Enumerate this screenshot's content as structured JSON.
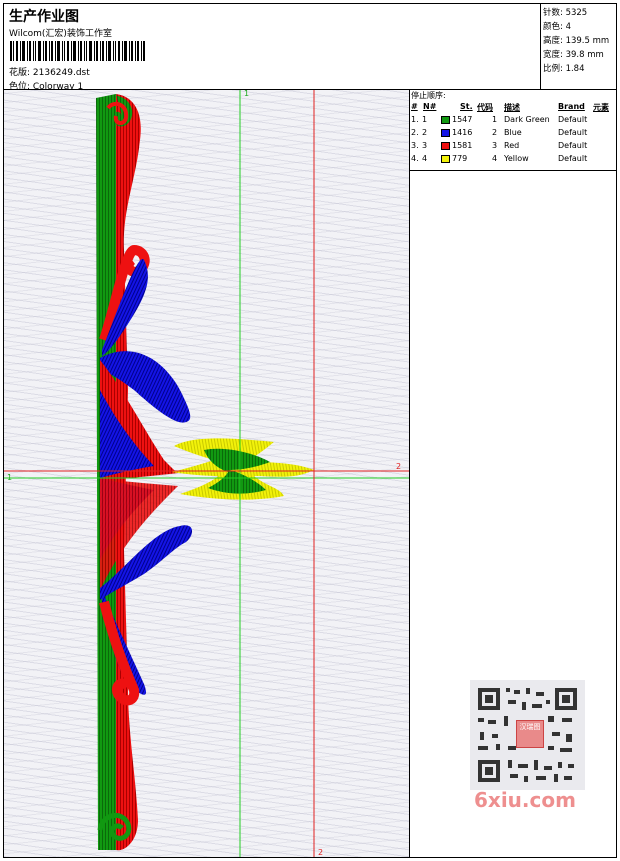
{
  "header": {
    "title": "生产作业图",
    "company": "Wilcom(汇宏)装饰工作室",
    "file_label": "花版: 2136249.dst",
    "color_label": "色位: Colorway 1"
  },
  "stats": {
    "stitches": "针数: 5325",
    "colors": "颜色: 4",
    "height": "高度: 139.5 mm",
    "width": "宽度: 39.8 mm",
    "scale": "比例: 1.84"
  },
  "stop_sequence": {
    "title": "停止顺序:",
    "headers": {
      "hash": "#",
      "n": "N#",
      "st": "St.",
      "code": "代码",
      "desc": "描述",
      "brand": "Brand",
      "element": "元素"
    },
    "rows": [
      {
        "hash": "1.",
        "n": "1",
        "st": "1547",
        "code": "1",
        "desc": "Dark Green",
        "brand": "Default",
        "color": "#119911"
      },
      {
        "hash": "2.",
        "n": "2",
        "st": "1416",
        "code": "2",
        "desc": "Blue",
        "brand": "Default",
        "color": "#1414e6"
      },
      {
        "hash": "3.",
        "n": "3",
        "st": "1581",
        "code": "3",
        "desc": "Red",
        "brand": "Default",
        "color": "#ee1111"
      },
      {
        "hash": "4.",
        "n": "4",
        "st": "779",
        "code": "4",
        "desc": "Yellow",
        "brand": "Default",
        "color": "#f2f20a"
      }
    ]
  },
  "guides": {
    "green_top": "1",
    "green_left": "1",
    "red_right": "2",
    "red_bottom": "2"
  },
  "watermark": {
    "text": "6xiu.com",
    "stamp": "汉瑞图"
  }
}
